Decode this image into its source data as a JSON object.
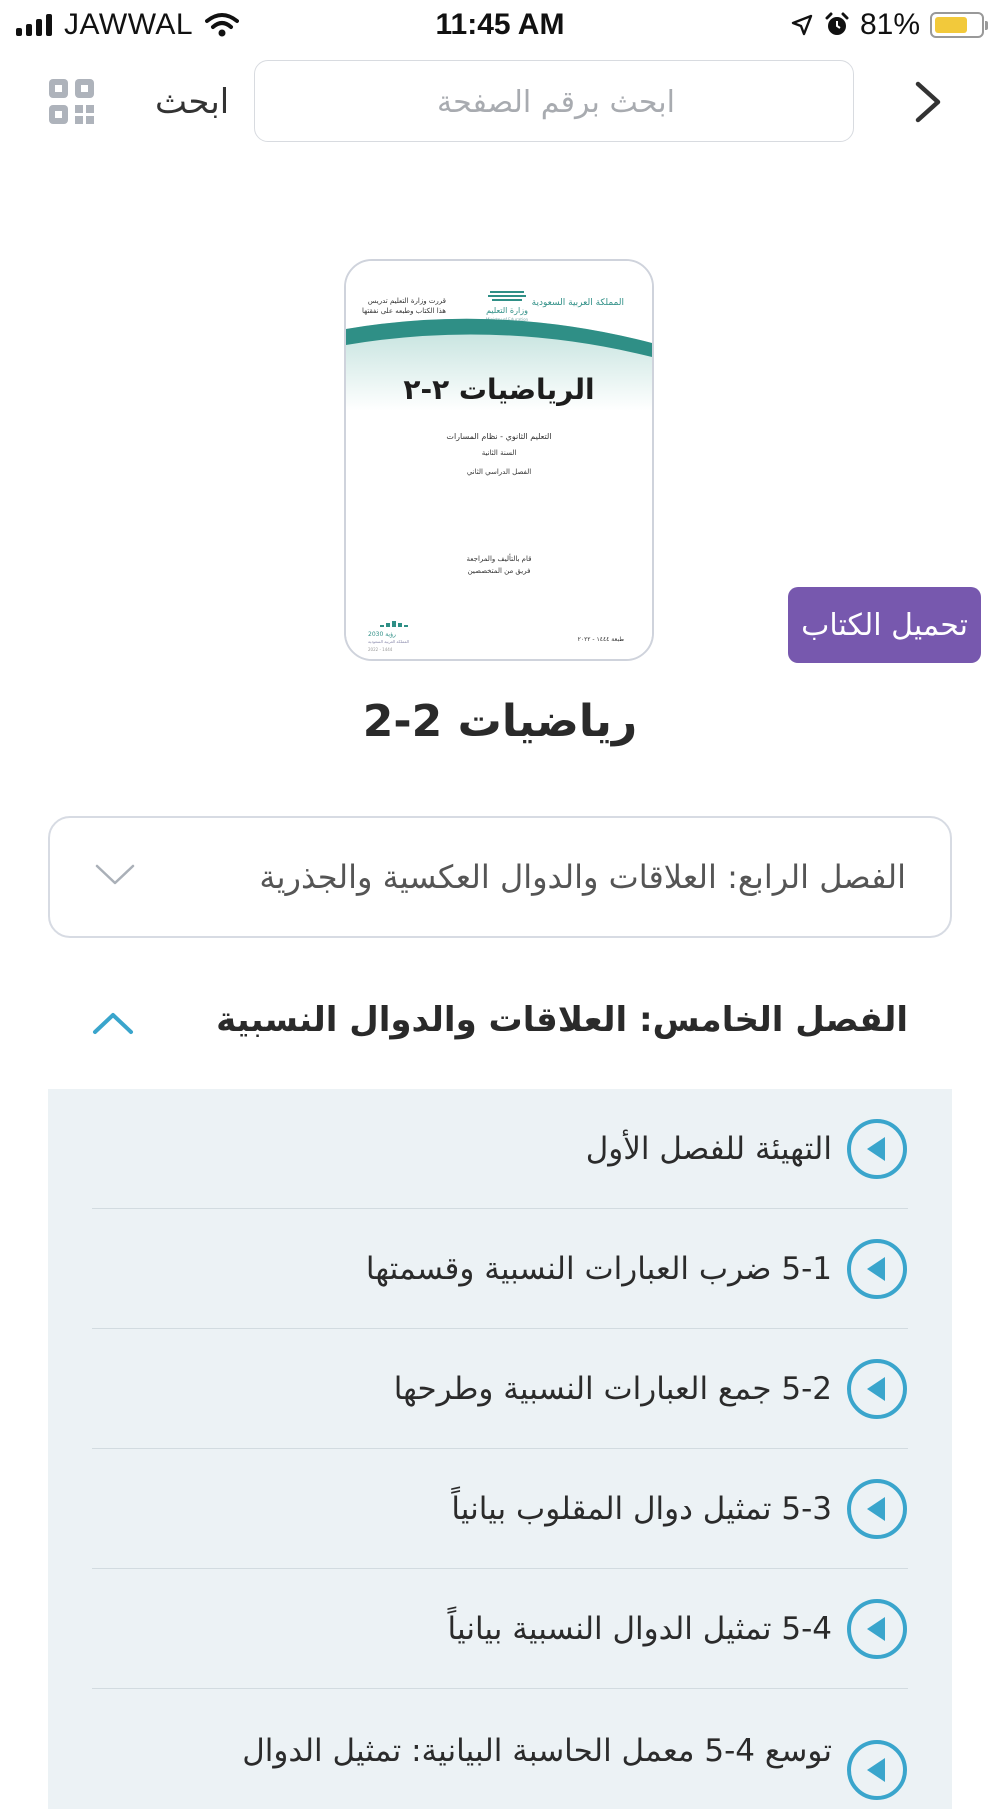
{
  "status_bar": {
    "carrier": "JAWWAL",
    "time": "11:45 AM",
    "battery": "81%",
    "battery_level": 0.81
  },
  "header": {
    "search_label": "ابحث",
    "search_placeholder": "ابحث برقم الصفحة"
  },
  "book": {
    "title": "رياضيات 2-2",
    "download_label": "تحميل الكتاب",
    "cover": {
      "kingdom": "المملكة العربية السعودية",
      "ministry": "وزارة التعليم",
      "ministry_sub": "Ministry of Education",
      "note_line1": "قررت وزارة التعليم تدريس",
      "note_line2": "هذا الكتاب وطبعه على نفقتها",
      "title": "الرياضيات ٢-٢",
      "line1": "التعليم الثانوي - نظام المسارات",
      "line2": "السنة الثانية",
      "line3": "الفصل الدراسي الثاني",
      "credit1": "قام بالتأليف والمراجعة",
      "credit2": "فريق من المتخصصين",
      "edition": "طبعة ١٤٤٤ - ٢٠٢٢",
      "vision": "رؤية 2030",
      "vision_sub": "المملكة العربية السعودية",
      "vision_year": "2022 - 1444"
    }
  },
  "chapter_select": {
    "value": "الفصل الرابع: العلاقات والدوال العكسية والجذرية"
  },
  "section": {
    "title": "الفصل الخامس: العلاقات والدوال النسبية",
    "lessons": [
      "التهيئة للفصل الأول",
      "5-1 ضرب العبارات النسبية وقسمتها",
      "5-2 جمع العبارات النسبية وطرحها",
      "5-3 تمثيل دوال المقلوب بيانياً",
      "5-4 تمثيل الدوال النسبية بيانياً",
      "توسع 4-5 معمل الحاسبة البيانية: تمثيل الدوال"
    ]
  },
  "colors": {
    "accent": "#7758ae",
    "play": "#3aa5cc",
    "teal": "#2f8f86",
    "panel": "#ecf2f5"
  },
  "icons": [
    "qr-code-icon",
    "chevron-right-icon",
    "chevron-down-icon",
    "chevron-up-icon",
    "play-icon",
    "location-arrow-icon",
    "alarm-icon",
    "wifi-icon",
    "signal-icon",
    "battery-icon"
  ]
}
